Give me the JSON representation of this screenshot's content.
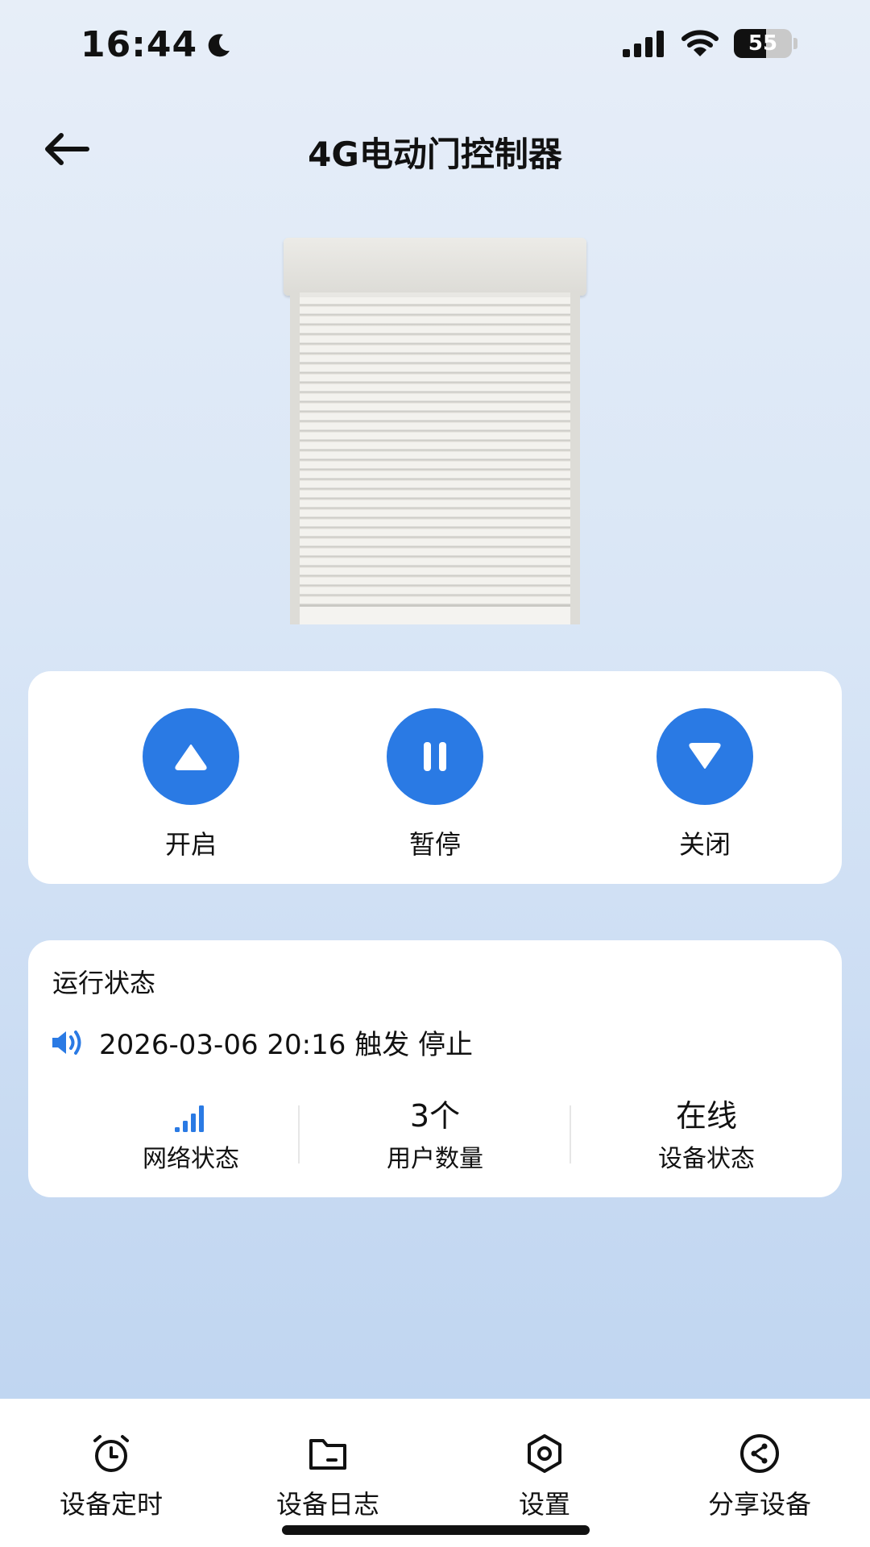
{
  "status_bar": {
    "time": "16:44",
    "battery": "55",
    "battery_level_percent": 55,
    "icons": [
      "moon-icon",
      "cellular-signal-icon",
      "wifi-icon",
      "battery-icon"
    ]
  },
  "header": {
    "title": "4G电动门控制器",
    "back_icon": "arrow-left-icon"
  },
  "controls": [
    {
      "label": "开启",
      "icon": "triangle-up-icon"
    },
    {
      "label": "暂停",
      "icon": "pause-icon"
    },
    {
      "label": "关闭",
      "icon": "triangle-down-icon"
    }
  ],
  "status": {
    "heading": "运行状态",
    "log_text": "2026-03-06 20:16 触发 停止",
    "log_icon": "speaker-icon",
    "network": {
      "label": "网络状态",
      "icon": "signal-bars-icon"
    },
    "users": {
      "value": "3个",
      "label": "用户数量"
    },
    "device": {
      "value": "在线",
      "label": "设备状态"
    }
  },
  "tabs": [
    {
      "label": "设备定时",
      "icon": "alarm-clock-icon"
    },
    {
      "label": "设备日志",
      "icon": "folder-icon"
    },
    {
      "label": "设置",
      "icon": "hexagon-settings-icon"
    },
    {
      "label": "分享设备",
      "icon": "share-icon"
    }
  ],
  "colors": {
    "accent": "#2a7ae4",
    "card": "#ffffff",
    "background_top": "#e7eef8",
    "background_bottom": "#bcd3f0"
  }
}
